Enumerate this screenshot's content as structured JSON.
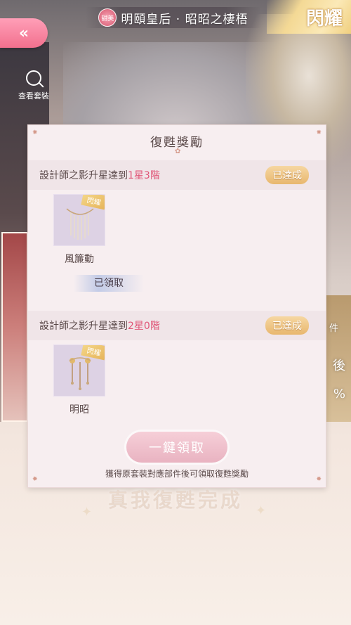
{
  "header": {
    "back_icon": "chevron-double-left-icon",
    "title_badge": "甜美",
    "title": "明頤皇后 · 昭昭之棲梧",
    "rarity": "閃耀",
    "view_outfit_label": "查看套裝"
  },
  "side_text": {
    "right_a": "件",
    "right_b": "後",
    "right_c": "%"
  },
  "modal": {
    "title": "復甦獎勵",
    "sections": [
      {
        "label_prefix": "設計師之影升星達到",
        "label_highlight": "1星3階",
        "status": "已達成",
        "item_tag": "閃耀",
        "item_name": "風簾動",
        "claimed": "已領取"
      },
      {
        "label_prefix": "設計師之影升星達到",
        "label_highlight": "2星0階",
        "status": "已達成",
        "item_tag": "閃耀",
        "item_name": "明昭"
      }
    ],
    "claim_all_label": "一鍵領取",
    "footnote": "獲得原套裝對應部件後可領取復甦獎勵"
  },
  "bottom_banner": "真我復甦完成",
  "colors": {
    "accent_pink": "#f2708e",
    "highlight_red": "#e05577",
    "badge_gold": "#e8b76e"
  }
}
